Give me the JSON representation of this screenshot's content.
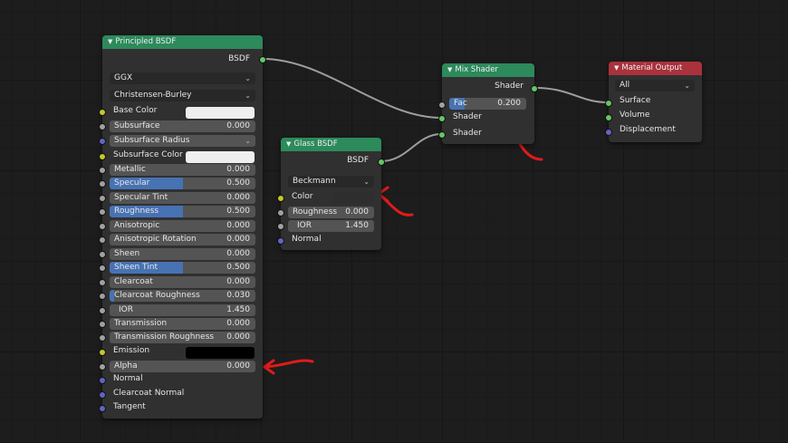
{
  "colors": {
    "shader_header": "#2c8a5b",
    "output_header": "#a9323c",
    "slider_fill": "#4772b3",
    "annotation": "#e01b1b"
  },
  "principled": {
    "title": "Principled BSDF",
    "output": "BSDF",
    "distribution": "GGX",
    "subsurface_method": "Christensen-Burley",
    "base_color_label": "Base Color",
    "subsurface": {
      "label": "Subsurface",
      "value": "0.000"
    },
    "subsurface_radius": "Subsurface Radius",
    "subsurface_color_label": "Subsurface Color",
    "metallic": {
      "label": "Metallic",
      "value": "0.000"
    },
    "specular": {
      "label": "Specular",
      "value": "0.500",
      "fill": 0.5
    },
    "specular_tint": {
      "label": "Specular Tint",
      "value": "0.000"
    },
    "roughness": {
      "label": "Roughness",
      "value": "0.500",
      "fill": 0.5
    },
    "anisotropic": {
      "label": "Anisotropic",
      "value": "0.000"
    },
    "anisotropic_rotation": {
      "label": "Anisotropic Rotation",
      "value": "0.000"
    },
    "sheen": {
      "label": "Sheen",
      "value": "0.000"
    },
    "sheen_tint": {
      "label": "Sheen Tint",
      "value": "0.500",
      "fill": 0.5
    },
    "clearcoat": {
      "label": "Clearcoat",
      "value": "0.000"
    },
    "clearcoat_roughness": {
      "label": "Clearcoat Roughness",
      "value": "0.030",
      "fill": 0.03
    },
    "ior": {
      "label": "IOR",
      "value": "1.450"
    },
    "transmission": {
      "label": "Transmission",
      "value": "0.000"
    },
    "transmission_roughness": {
      "label": "Transmission Roughness",
      "value": "0.000"
    },
    "emission_label": "Emission",
    "alpha": {
      "label": "Alpha",
      "value": "0.000"
    },
    "normal": "Normal",
    "clearcoat_normal": "Clearcoat Normal",
    "tangent": "Tangent"
  },
  "glass": {
    "title": "Glass BSDF",
    "output": "BSDF",
    "distribution": "Beckmann",
    "color_label": "Color",
    "roughness": {
      "label": "Roughness",
      "value": "0.000"
    },
    "ior": {
      "label": "IOR",
      "value": "1.450"
    },
    "normal": "Normal"
  },
  "mix": {
    "title": "Mix Shader",
    "output": "Shader",
    "fac": {
      "label": "Fac",
      "value": "0.200",
      "fill": 0.2
    },
    "shader1": "Shader",
    "shader2": "Shader"
  },
  "material_output": {
    "title": "Material Output",
    "target": "All",
    "surface": "Surface",
    "volume": "Volume",
    "displacement": "Displacement"
  }
}
